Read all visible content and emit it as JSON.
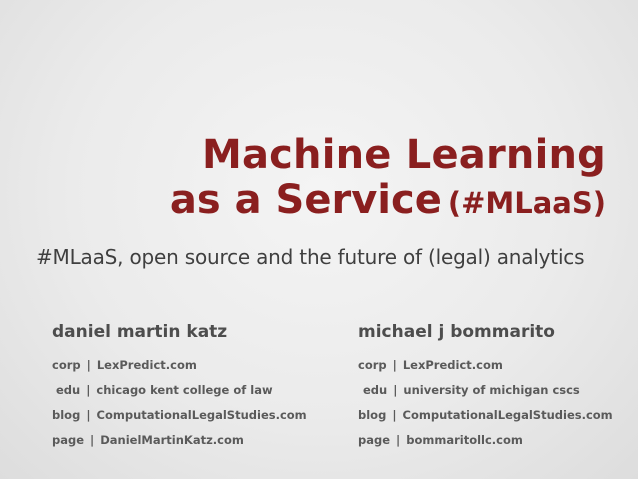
{
  "title": {
    "line1": "Machine Learning",
    "line2": "as a Service",
    "tag": "(#MLaaS)"
  },
  "subtitle": "#MLaaS, open source and the future of (legal) analytics",
  "authors": [
    {
      "name": "daniel martin katz",
      "rows": [
        {
          "key": "corp",
          "sep": "|",
          "value": "LexPredict.com"
        },
        {
          "key": "edu",
          "sep": "|",
          "value": "chicago kent college of law"
        },
        {
          "key": "blog",
          "sep": "|",
          "value": "ComputationalLegalStudies.com"
        },
        {
          "key": "page",
          "sep": "|",
          "value": "DanielMartinKatz.com"
        }
      ]
    },
    {
      "name": "michael j bommarito",
      "rows": [
        {
          "key": "corp",
          "sep": "|",
          "value": "LexPredict.com"
        },
        {
          "key": "edu",
          "sep": "|",
          "value": "university of michigan cscs"
        },
        {
          "key": "blog",
          "sep": "|",
          "value": "ComputationalLegalStudies.com"
        },
        {
          "key": "page",
          "sep": "|",
          "value": "bommaritollc.com"
        }
      ]
    }
  ],
  "colors": {
    "title": "#8a1f1f",
    "subtitle": "#3f3f3f",
    "author_text": "#5a5a5a",
    "background": "#ebebeb"
  }
}
